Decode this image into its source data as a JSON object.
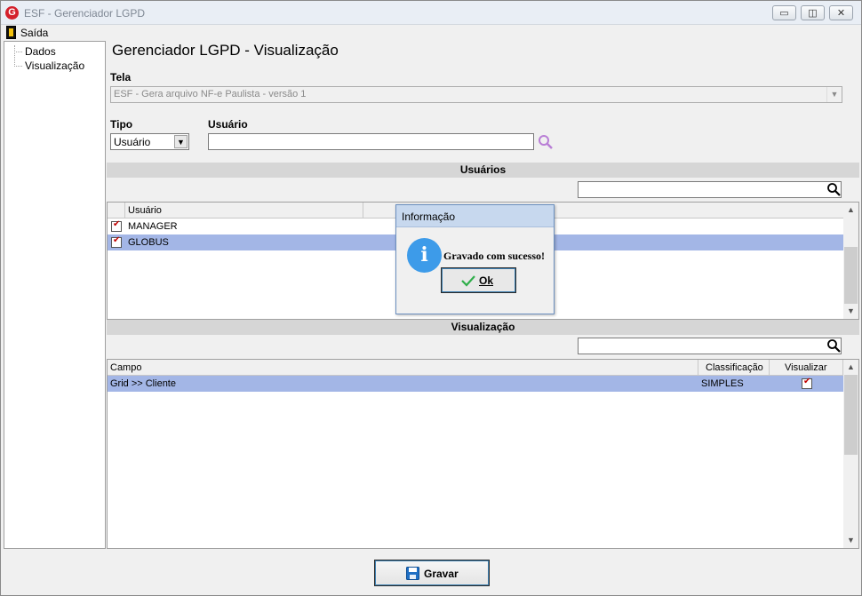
{
  "window": {
    "title": "ESF - Gerenciador LGPD",
    "logo_letter": "G",
    "minimize_glyph": "▭",
    "maximize_glyph": "◫",
    "close_glyph": "✕"
  },
  "menu": {
    "saida": "Saída"
  },
  "tree": {
    "items": [
      "Dados",
      "Visualização"
    ]
  },
  "page": {
    "title": "Gerenciador LGPD - Visualização"
  },
  "tela": {
    "label": "Tela",
    "value": "ESF - Gera arquivo NF-e Paulista - versão 1"
  },
  "tipo": {
    "label": "Tipo",
    "value": "Usuário"
  },
  "usuario": {
    "label": "Usuário",
    "value": ""
  },
  "usuarios_section": {
    "title": "Usuários",
    "filter_value": "",
    "column_header": "Usuário",
    "rows": [
      {
        "checked": true,
        "name": "MANAGER",
        "selected": false
      },
      {
        "checked": true,
        "name": "GLOBUS",
        "selected": true
      }
    ]
  },
  "visualizacao_section": {
    "title": "Visualização",
    "filter_value": "",
    "columns": [
      "Campo",
      "Classificação",
      "Visualizar"
    ],
    "rows": [
      {
        "campo": "Grid >> Cliente",
        "classificacao": "SIMPLES",
        "visualizar": true,
        "selected": true
      }
    ]
  },
  "dialog": {
    "title": "Informação",
    "icon_letter": "i",
    "message": "Gravado com sucesso!",
    "ok_label": "Ok"
  },
  "footer": {
    "gravar_label": "Gravar"
  },
  "colors": {
    "selection": "#a3b6e6",
    "section_bar": "#d6d6d6",
    "dialog_title": "#c7d8ee",
    "info_icon": "#3d9be9",
    "search_icon": "#b97fd6"
  }
}
